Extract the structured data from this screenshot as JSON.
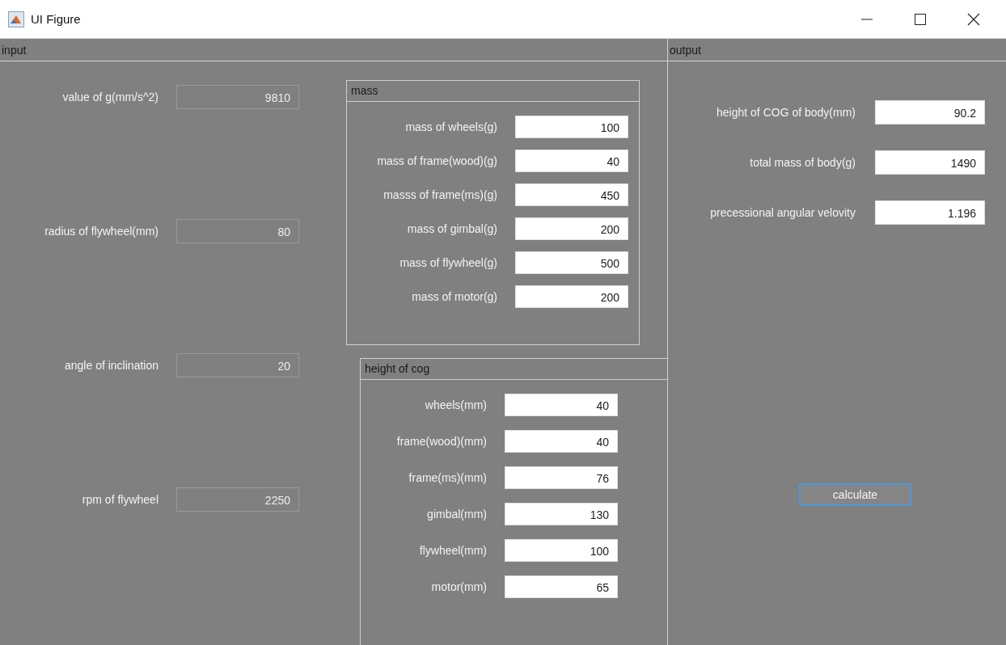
{
  "window": {
    "title": "UI Figure"
  },
  "input": {
    "title": "input",
    "fields": [
      {
        "label": "value of g(mm/s^2)",
        "value": "9810",
        "kind": "dim"
      },
      {
        "label": "radius of flywheel(mm)",
        "value": "80",
        "kind": "dim"
      },
      {
        "label": "angle of inclination",
        "value": "20",
        "kind": "dim"
      },
      {
        "label": "rpm of flywheel",
        "value": "2250",
        "kind": "dim"
      }
    ],
    "mass": {
      "title": "mass",
      "fields": [
        {
          "label": "mass of wheels(g)",
          "value": "100",
          "kind": "bright"
        },
        {
          "label": "mass of frame(wood)(g)",
          "value": "40",
          "kind": "bright"
        },
        {
          "label": "masss of frame(ms)(g)",
          "value": "450",
          "kind": "bright"
        },
        {
          "label": "mass of gimbal(g)",
          "value": "200",
          "kind": "bright"
        },
        {
          "label": "mass of flywheel(g)",
          "value": "500",
          "kind": "bright"
        },
        {
          "label": "mass of motor(g)",
          "value": "200",
          "kind": "bright"
        }
      ]
    },
    "cog": {
      "title": "height of cog",
      "fields": [
        {
          "label": "wheels(mm)",
          "value": "40",
          "kind": "bright"
        },
        {
          "label": "frame(wood)(mm)",
          "value": "40",
          "kind": "bright"
        },
        {
          "label": "frame(ms)(mm)",
          "value": "76",
          "kind": "bright"
        },
        {
          "label": "gimbal(mm)",
          "value": "130",
          "kind": "bright"
        },
        {
          "label": "flywheel(mm)",
          "value": "100",
          "kind": "bright"
        },
        {
          "label": "motor(mm)",
          "value": "65",
          "kind": "bright"
        }
      ]
    }
  },
  "output": {
    "title": "output",
    "fields": [
      {
        "label": "height of COG of body(mm)",
        "value": "90.2",
        "kind": "bright"
      },
      {
        "label": "total mass of body(g)",
        "value": "1490",
        "kind": "bright"
      },
      {
        "label": "precessional angular velovity",
        "value": "1.196",
        "kind": "bright"
      }
    ],
    "button": "calculate"
  }
}
